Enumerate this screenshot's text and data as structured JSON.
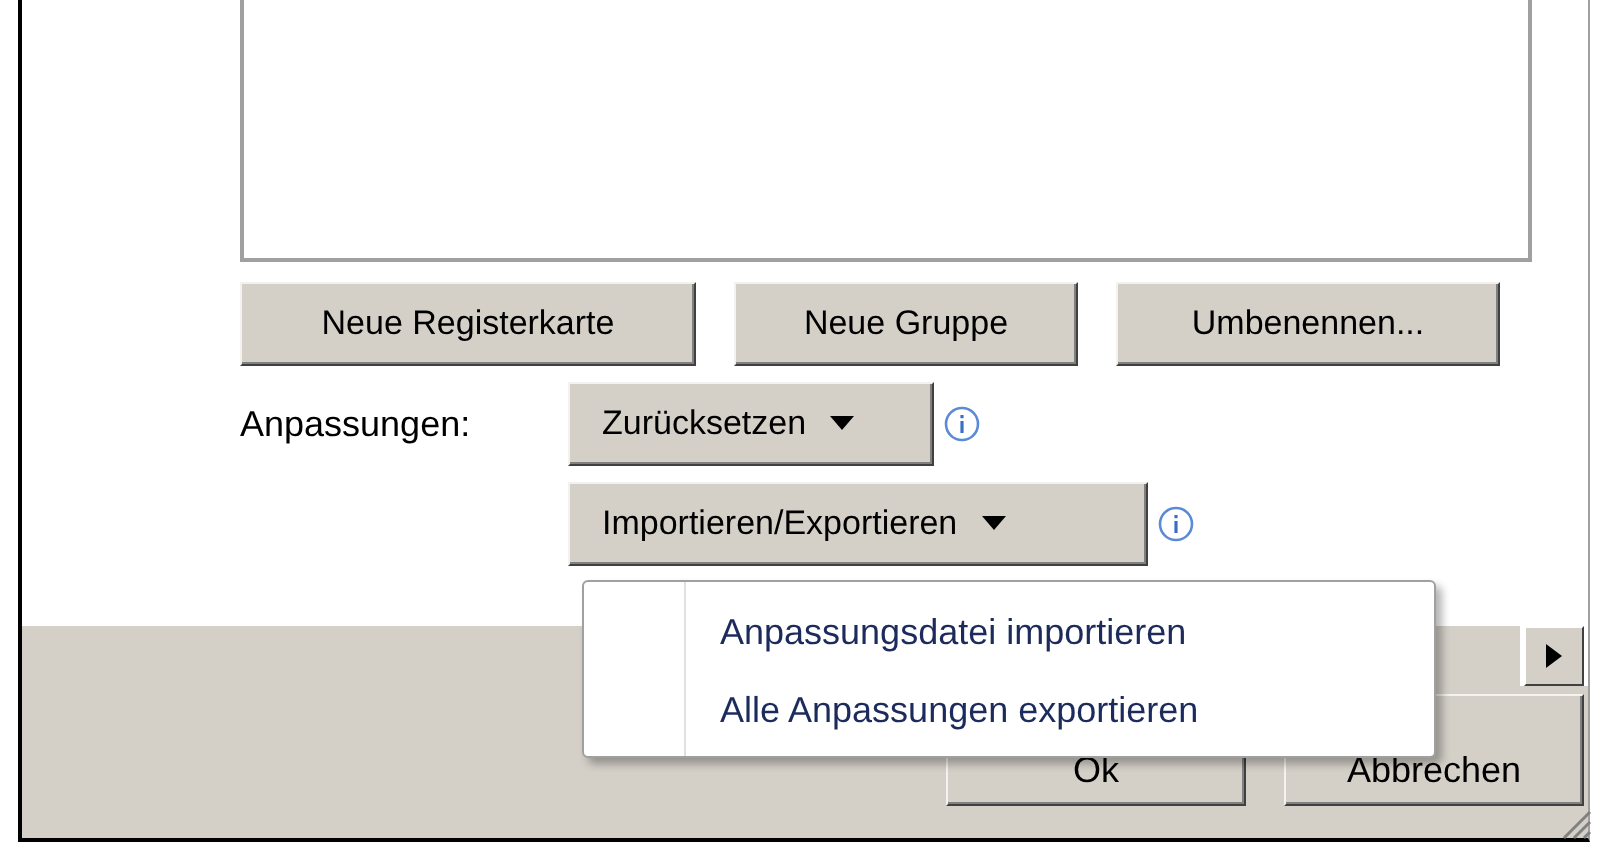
{
  "buttons": [
    "Neue Registerkarte",
    "Neue Gruppe",
    "Umbenennen..."
  ],
  "customizations": {
    "label": "Anpassungen:",
    "reset_button": "Zurücksetzen",
    "import_export_button": "Importieren/Exportieren"
  },
  "menu": {
    "items": [
      "Anpassungsdatei importieren",
      "Alle Anpassungen exportieren"
    ]
  },
  "dialog_buttons": [
    "Ok",
    "Abbrechen"
  ]
}
